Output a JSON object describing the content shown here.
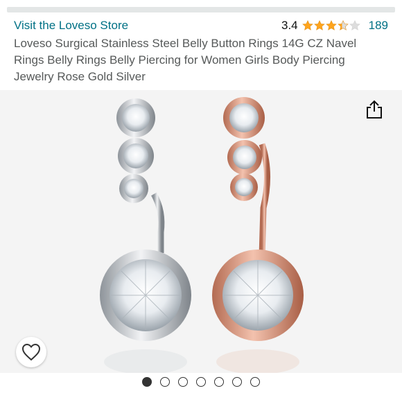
{
  "store": {
    "link_label": "Visit the Loveso Store"
  },
  "rating": {
    "value": "3.4",
    "stars_filled": 3.4,
    "stars_total": 5,
    "count": "189",
    "star_color": "#ffa41c",
    "star_empty_color": "#dddddd"
  },
  "product": {
    "title": "Loveso Surgical Stainless Steel Belly Button Rings 14G CZ Navel Rings Belly Rings Belly Piercing for Women Girls Body Piercing Jewelry Rose Gold Silver"
  },
  "gallery": {
    "image_count": 7,
    "active_index": 0,
    "share_icon": "share-icon",
    "favorite_icon": "heart-icon",
    "variants": [
      "silver",
      "rose-gold"
    ]
  },
  "colors": {
    "link": "#007185",
    "text": "#0f1111",
    "muted": "#565959",
    "silver": "#c9ccd1",
    "rose_gold": "#d99a7e"
  }
}
